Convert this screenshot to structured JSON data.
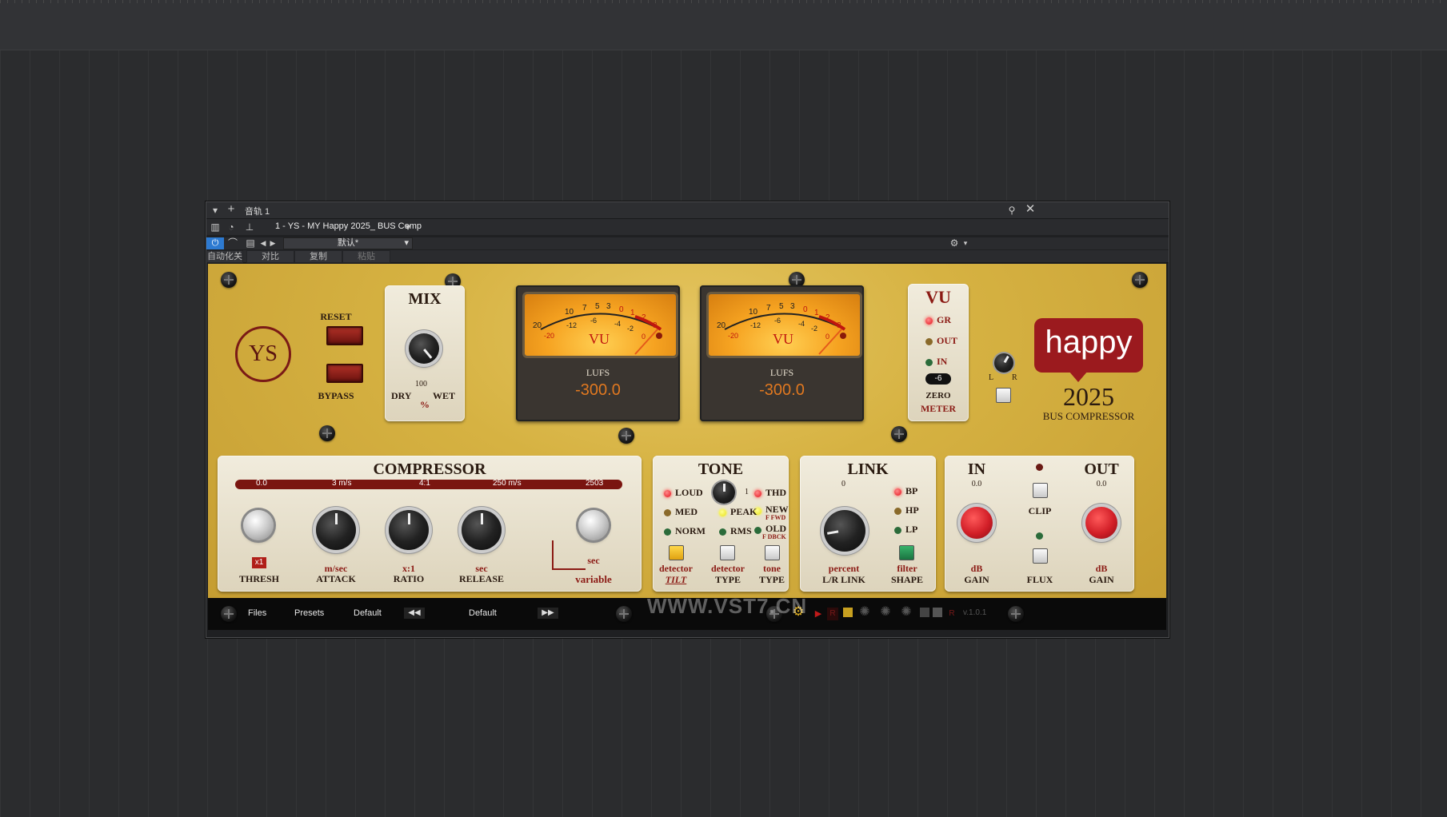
{
  "window": {
    "track_name": "音轨 1",
    "plugin_name": "1 - YS - MY Happy 2025_ BUS Comp",
    "preset_dropdown": "默认*",
    "automation_label": "自动化关",
    "compare_label": "对比",
    "copy_label": "复制",
    "paste_label": "粘贴"
  },
  "plugin": {
    "logo_ys": "YS",
    "reset_label": "RESET",
    "bypass_label": "BYPASS",
    "mix": {
      "title": "MIX",
      "dry": "DRY",
      "wet": "WET",
      "value": "100",
      "unit": "%"
    },
    "meter_left": {
      "scale": [
        "20",
        "10",
        "7",
        "5",
        "3",
        "0",
        "1",
        "2",
        "3"
      ],
      "neg": [
        "-20",
        "-12",
        "-6",
        "-4",
        "-2",
        "0"
      ],
      "vu": "VU",
      "lufs_label": "LUFS",
      "lufs_value": "-300.0"
    },
    "meter_right": {
      "scale": [
        "20",
        "10",
        "7",
        "5",
        "3",
        "0",
        "1",
        "2",
        "3"
      ],
      "neg": [
        "-20",
        "-12",
        "-6",
        "-4",
        "-2",
        "0"
      ],
      "vu": "VU",
      "lufs_label": "LUFS",
      "lufs_value": "-300.0"
    },
    "vu_panel": {
      "title": "VU",
      "gr": "GR",
      "out": "OUT",
      "in": "IN",
      "zero_value": "-6",
      "zero_label": "ZERO",
      "meter_label": "METER"
    },
    "lr": {
      "l": "L",
      "r": "R"
    },
    "brand": {
      "name": "happy",
      "year": "2025",
      "subtitle": "BUS COMPRESSOR"
    },
    "compressor": {
      "title": "COMPRESSOR",
      "strip": [
        "0.0",
        "3 m/s",
        "4:1",
        "250 m/s",
        "2503"
      ],
      "thresh_badge": "x1",
      "thresh": "THRESH",
      "attack_unit": "m/sec",
      "attack": "ATTACK",
      "ratio_unit": "x:1",
      "ratio": "RATIO",
      "release_unit": "sec",
      "release": "RELEASE",
      "variable_unit": "sec",
      "variable": "variable"
    },
    "tone": {
      "title": "TONE",
      "loud": "LOUD",
      "med": "MED",
      "norm": "NORM",
      "knob_value": "1",
      "thd": "THD",
      "new": "NEW",
      "new_sub": "F FWD",
      "old": "OLD",
      "old_sub": "F DBCK",
      "peak": "PEAK",
      "rms": "RMS",
      "detector_tilt_1": "detector",
      "detector_tilt_2": "TILT",
      "detector_type_1": "detector",
      "detector_type_2": "TYPE",
      "tone_type_1": "tone",
      "tone_type_2": "TYPE"
    },
    "link": {
      "title": "LINK",
      "value": "0",
      "bp": "BP",
      "hp": "HP",
      "lp": "LP",
      "percent": "percent",
      "lr_link": "L/R LINK",
      "filter": "filter",
      "shape": "SHAPE"
    },
    "io": {
      "in_title": "IN",
      "in_value": "0.0",
      "out_title": "OUT",
      "out_value": "0.0",
      "clip": "CLIP",
      "flux": "FLUX",
      "db": "dB",
      "gain": "GAIN"
    },
    "bottom": {
      "files": "Files",
      "presets": "Presets",
      "default1": "Default",
      "default2": "Default",
      "prev": "◀◀",
      "next": "▶▶",
      "version": "v.1.0.1"
    },
    "watermark": "WWW.VST7.CN"
  },
  "colors": {
    "gold": "#d6b242",
    "brand_red": "#9b1a1e",
    "lufs_orange": "#e07820"
  }
}
